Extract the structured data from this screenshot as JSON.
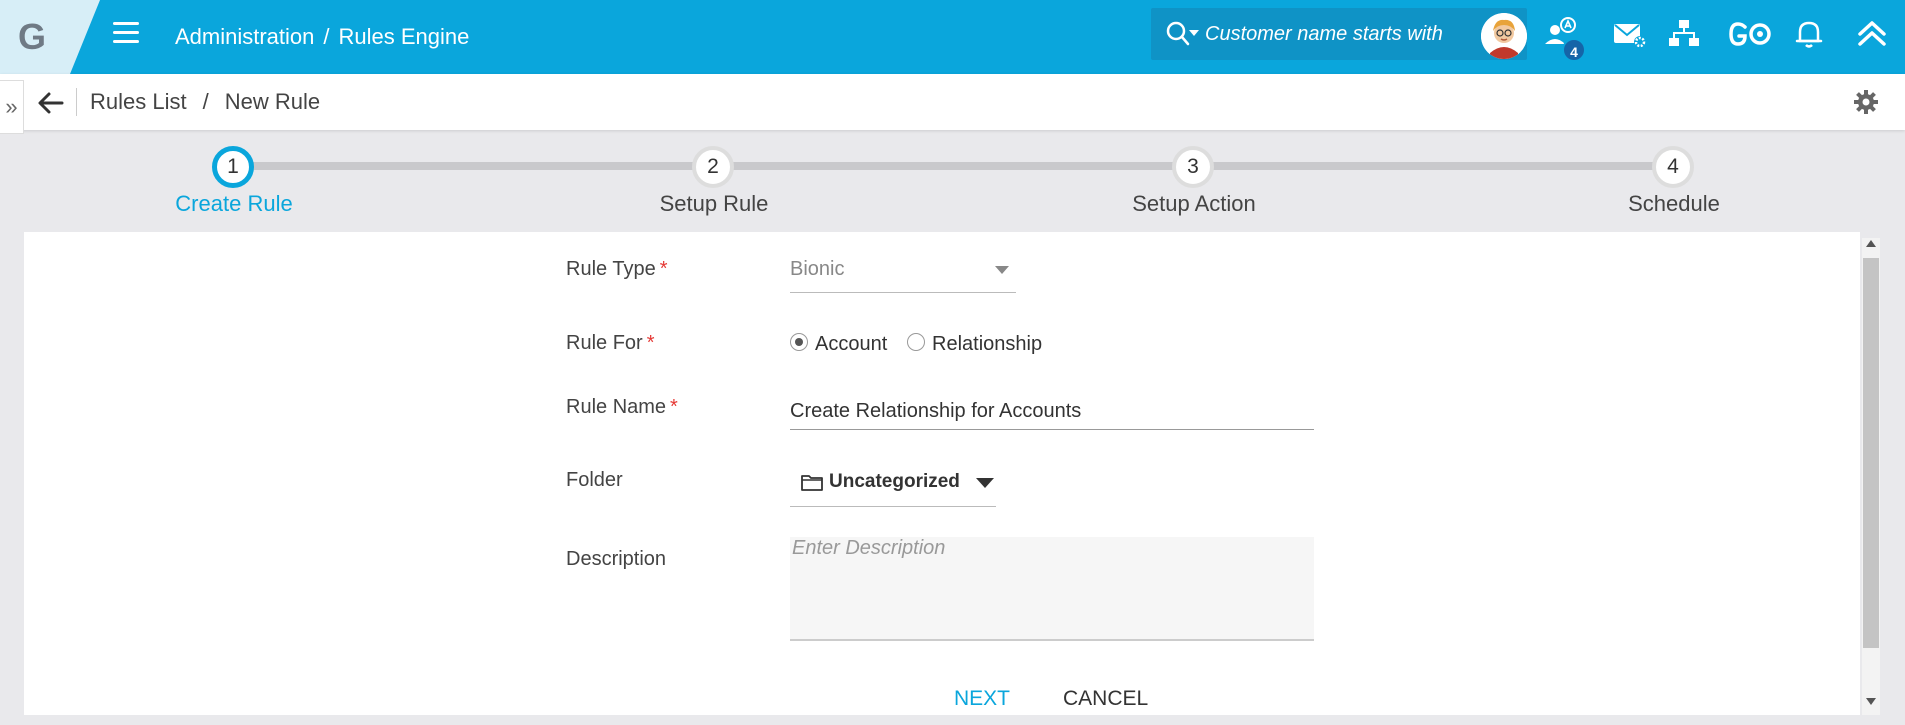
{
  "app": {
    "logo_letter": "G",
    "breadcrumb": [
      "Administration",
      "Rules Engine"
    ],
    "breadcrumb_separator": "/",
    "search": {
      "placeholder": "Customer name starts with"
    },
    "notifications_badge": "4",
    "icons": [
      "search-icon",
      "avatar",
      "user-switch-icon",
      "mail-settings-icon",
      "hierarchy-icon",
      "go-icon",
      "bell-icon",
      "chevron-up-double-icon"
    ],
    "accent_color": "#0aa6dc"
  },
  "subnav": {
    "breadcrumb": [
      "Rules List",
      "New Rule"
    ],
    "breadcrumb_separator": "/"
  },
  "stepper": {
    "steps": [
      {
        "number": "1",
        "label": "Create Rule",
        "active": true
      },
      {
        "number": "2",
        "label": "Setup Rule",
        "active": false
      },
      {
        "number": "3",
        "label": "Setup Action",
        "active": false
      },
      {
        "number": "4",
        "label": "Schedule",
        "active": false
      }
    ]
  },
  "form": {
    "rule_type": {
      "label": "Rule Type",
      "required_mark": "*",
      "value": "Bionic"
    },
    "rule_for": {
      "label": "Rule For",
      "required_mark": "*",
      "options": [
        "Account",
        "Relationship"
      ],
      "selected": "Account"
    },
    "rule_name": {
      "label": "Rule Name",
      "required_mark": "*",
      "value": "Create Relationship for Accounts"
    },
    "folder": {
      "label": "Folder",
      "value": "Uncategorized"
    },
    "description": {
      "label": "Description",
      "placeholder": "Enter Description",
      "value": ""
    }
  },
  "actions": {
    "next_label": "NEXT",
    "cancel_label": "CANCEL"
  }
}
